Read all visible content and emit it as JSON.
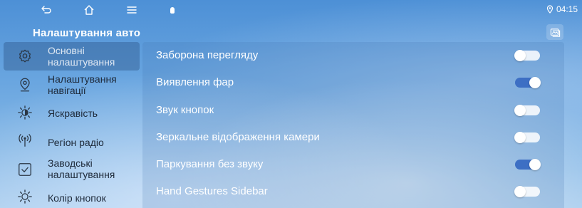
{
  "status_bar": {
    "time": "04:15"
  },
  "header": {
    "title": "Налаштування авто"
  },
  "sidebar": {
    "items": [
      {
        "label": "Основні налаштування",
        "active": true,
        "icon": "gear-icon"
      },
      {
        "label": "Налаштування навігації",
        "active": false,
        "icon": "location-pin-icon"
      },
      {
        "label": "Яскравість",
        "active": false,
        "icon": "brightness-icon"
      },
      {
        "label": "Регіон радіо",
        "active": false,
        "icon": "radio-signal-icon"
      },
      {
        "label": "Заводські налаштування",
        "active": false,
        "icon": "checkbox-icon"
      },
      {
        "label": "Колір кнопок",
        "active": false,
        "icon": "sun-icon"
      }
    ]
  },
  "settings": {
    "rows": [
      {
        "label": "Заборона перегляду",
        "on": false
      },
      {
        "label": "Виявлення фар",
        "on": true
      },
      {
        "label": "Звук кнопок",
        "on": false
      },
      {
        "label": "Зеркальне відображення камери",
        "on": false
      },
      {
        "label": "Паркування без звуку",
        "on": true
      },
      {
        "label": "Hand Gestures Sidebar",
        "on": false
      }
    ]
  },
  "colors": {
    "toggle_on": "#3d6fc4",
    "active_item_bg": "#28507f"
  }
}
